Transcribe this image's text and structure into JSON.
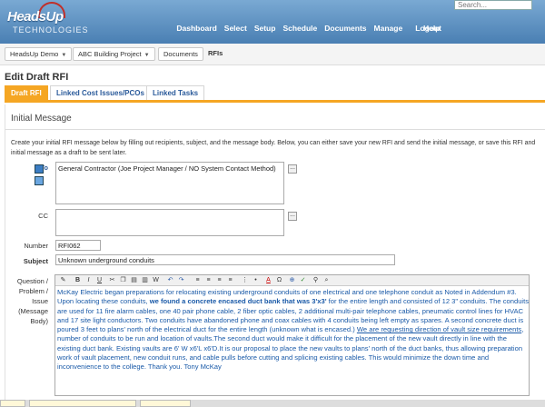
{
  "header": {
    "logo_line1": "HeadsUp",
    "logo_line2": "TECHNOLOGIES",
    "search_placeholder": "Search...",
    "nav": [
      "Dashboard",
      "Select",
      "Setup",
      "Schedule",
      "Documents",
      "Manage",
      "Logout",
      "Help"
    ]
  },
  "breadcrumb": {
    "items": [
      "HeadsUp Demo",
      "ABC Building Project",
      "Documents",
      "RFIs"
    ]
  },
  "page": {
    "title": "Edit Draft RFI",
    "tabs": [
      "Draft RFI",
      "Linked Cost Issues/PCOs",
      "Linked Tasks"
    ],
    "section_title": "Initial Message",
    "instructions": "Create your initial RFI message below by filling out recipients, subject, and the message body. Below, you can either save your new RFI and send the initial message, or save this RFI and initial message as a draft to be sent later."
  },
  "form": {
    "to_label": "To",
    "to_value": "General Contractor (Joe Project Manager / NO System Contact Method)",
    "cc_label": "CC",
    "cc_value": "",
    "number_label": "Number",
    "number_value": "RFI062",
    "subject_label": "Subject",
    "subject_value": "Unknown underground conduits",
    "body_label_1": "Question /",
    "body_label_2": "Problem /",
    "body_label_3": "Issue",
    "body_label_4": "(Message",
    "body_label_5": "Body)",
    "dots": "..."
  },
  "editor": {
    "body_part1": "McKay Electric began preparations for relocating existing underground conduits of one electrical and one telephone conduit as Noted in Addendum #3. Upon locating these conduits, ",
    "body_bold": "we found a concrete encased duct bank that was 3'x3'",
    "body_part2": " for the entire length and consisted of 12 3\" conduits. The conduits are used for 11 fire alarm cables, one 40 pair phone cable, 2 fiber optic cables, 2 additional multi-pair telephone cables, pneumatic control lines for HVAC and 17 site light conductors. Two conduits have abandoned phone and coax cables with 4 conduits being left empty as spares. A second concrete duct is poured 3 feet to plans' north of the electrical duct for the entire length (unknown what is encased.)  ",
    "body_underline": "We are requesting direction of vault size requirements",
    "body_part3": ", number of conduits to be run and location of vaults.The second duct would make it difficult for the placement of the new vault directly in line with the existing duct bank. Existing vaults are 6' W x6'L x6'D.It is our proposal to place the new vaults to plans' north of the duct banks, thus allowing preparation work of vault placement, new conduit runs, and cable pulls before cutting and splicing existing cables. This would minimize the down time and inconvenience to the college.  Thank you.  Tony McKay",
    "toolbar_icons": [
      "bold",
      "italic",
      "underline",
      "cut",
      "copy",
      "paste",
      "paste-text",
      "paste-word",
      "undo",
      "redo",
      "align-left",
      "align-center",
      "align-right",
      "align-justify",
      "ordered-list",
      "unordered-list",
      "font-color",
      "special-char",
      "link",
      "spell-check",
      "find",
      "replace"
    ]
  },
  "colors": {
    "header_blue": "#4a7fb3",
    "tab_orange": "#f5a623",
    "body_text_blue": "#1a5aa8"
  }
}
